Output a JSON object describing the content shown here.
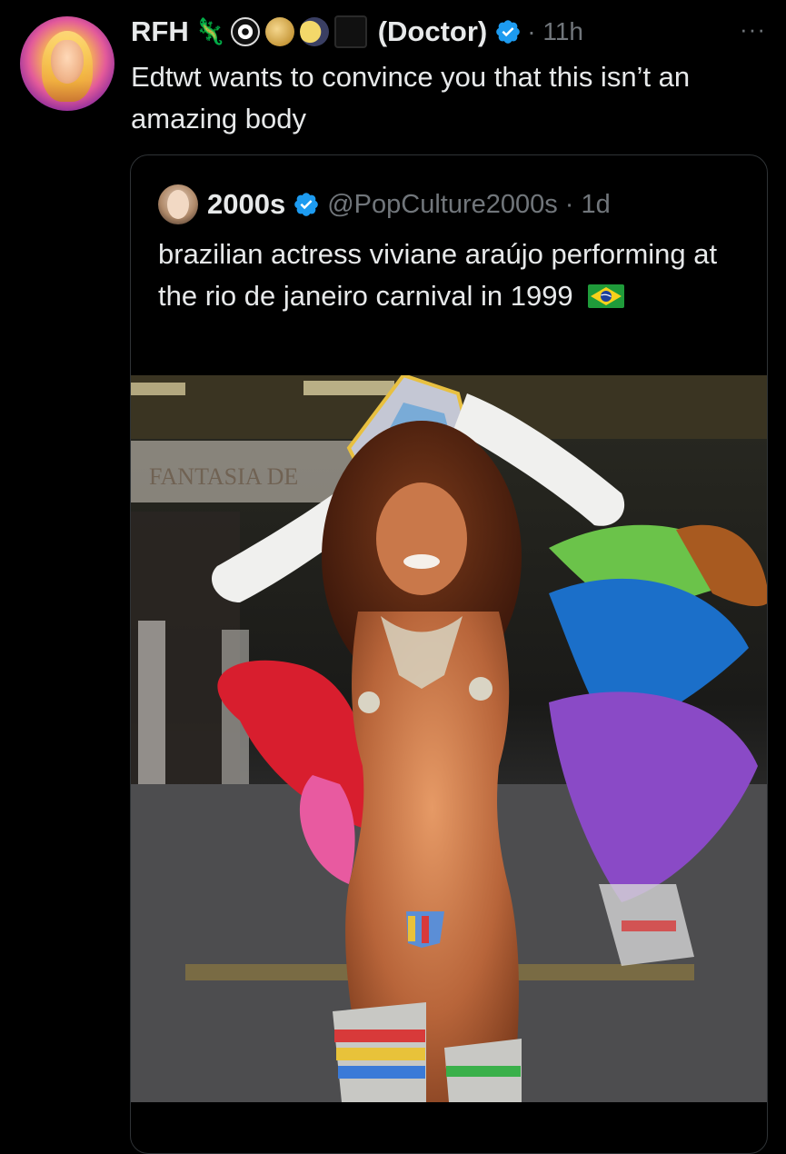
{
  "tweet": {
    "display_name": "RFH",
    "name_suffix": "(Doctor)",
    "time": "· 11h",
    "more_label": "···",
    "text": "Edtwt wants to convince you that this isn’t an amazing body",
    "icons": [
      "avatar-icon",
      "lizard-emoji",
      "eye-emoji",
      "saturn-emoji",
      "moon-emoji",
      "black-square-emoji",
      "verified-icon",
      "more-icon"
    ],
    "colors": {
      "verified": "#1d9bf0",
      "secondary_text": "#71767b",
      "background": "#000000"
    }
  },
  "quote": {
    "display_name": "2000s",
    "handle": "@PopCulture2000s",
    "time": "· 1d",
    "text": "brazilian actress viviane araújo performing at the rio de janeiro carnival in 1999",
    "flag": "brazil-flag-icon",
    "photo_sign_text": "FANTASIA DE"
  }
}
